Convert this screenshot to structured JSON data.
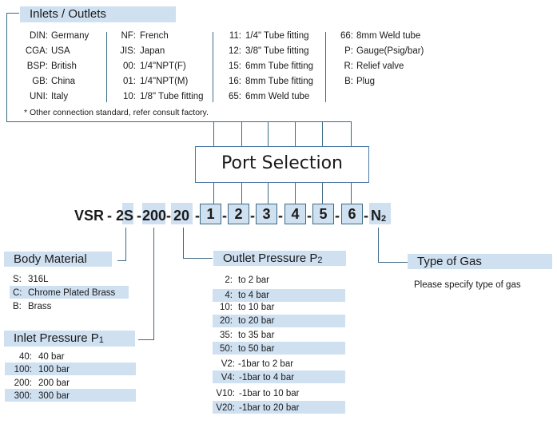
{
  "inlets_outlets": {
    "title": "Inlets / Outlets",
    "col1": [
      {
        "code": "DIN:",
        "desc": "Germany"
      },
      {
        "code": "CGA:",
        "desc": "USA"
      },
      {
        "code": "BSP:",
        "desc": "British"
      },
      {
        "code": "GB:",
        "desc": "China"
      },
      {
        "code": "UNI:",
        "desc": "Italy"
      }
    ],
    "col2": [
      {
        "code": "NF:",
        "desc": "French"
      },
      {
        "code": "JIS:",
        "desc": "Japan"
      },
      {
        "code": "00:",
        "desc": "1/4\"NPT(F)"
      },
      {
        "code": "01:",
        "desc": "1/4\"NPT(M)"
      },
      {
        "code": "10:",
        "desc": "1/8\" Tube fitting"
      }
    ],
    "col3": [
      {
        "code": "11:",
        "desc": "1/4\" Tube fitting"
      },
      {
        "code": "12:",
        "desc": "3/8\" Tube fitting"
      },
      {
        "code": "15:",
        "desc": "6mm Tube fitting"
      },
      {
        "code": "16:",
        "desc": "8mm Tube fitting"
      },
      {
        "code": "65:",
        "desc": "6mm Weld tube"
      }
    ],
    "col4": [
      {
        "code": "66:",
        "desc": "8mm Weld tube"
      },
      {
        "code": "P:",
        "desc": "Gauge(Psig/bar)"
      },
      {
        "code": "R:",
        "desc": "Relief valve"
      },
      {
        "code": "B:",
        "desc": "Plug"
      }
    ],
    "note": "* Other connection standard, refer consult factory."
  },
  "port_selection": {
    "title": "Port Selection"
  },
  "model_code": {
    "prefix": "VSR",
    "body": "2S",
    "inlet": "200",
    "outlet": "20",
    "ports": [
      "1",
      "2",
      "3",
      "4",
      "5",
      "6"
    ],
    "gas": "N",
    "gas_sub": "2",
    "separator": "-"
  },
  "body_material": {
    "title": "Body Material",
    "items": [
      {
        "code": "S:",
        "desc": "316L"
      },
      {
        "code": "C:",
        "desc": "Chrome Plated Brass"
      },
      {
        "code": "B:",
        "desc": "Brass"
      }
    ]
  },
  "inlet_pressure": {
    "title": "Inlet Pressure P",
    "title_sub": "1",
    "items": [
      {
        "code": "40:",
        "desc": "40 bar"
      },
      {
        "code": "100:",
        "desc": "100 bar"
      },
      {
        "code": "200:",
        "desc": "200 bar"
      },
      {
        "code": "300:",
        "desc": "300 bar"
      }
    ]
  },
  "outlet_pressure": {
    "title": "Outlet Pressure P",
    "title_sub": "2",
    "items": [
      {
        "code": "2:",
        "desc": "to 2 bar"
      },
      {
        "code": "4:",
        "desc": "to 4 bar"
      },
      {
        "code": "10:",
        "desc": "to 10 bar"
      },
      {
        "code": "20:",
        "desc": "to 20 bar"
      },
      {
        "code": "35:",
        "desc": "to 35 bar"
      },
      {
        "code": "50:",
        "desc": "to 50 bar"
      },
      {
        "code": "V2:",
        "desc": "-1bar to 2 bar"
      },
      {
        "code": "V4:",
        "desc": "-1bar to 4 bar"
      },
      {
        "code": "V10:",
        "desc": "-1bar to 10 bar"
      },
      {
        "code": "V20:",
        "desc": "-1bar to 20 bar"
      }
    ]
  },
  "gas_type": {
    "title": "Type of Gas",
    "note": "Please specify type of gas"
  }
}
